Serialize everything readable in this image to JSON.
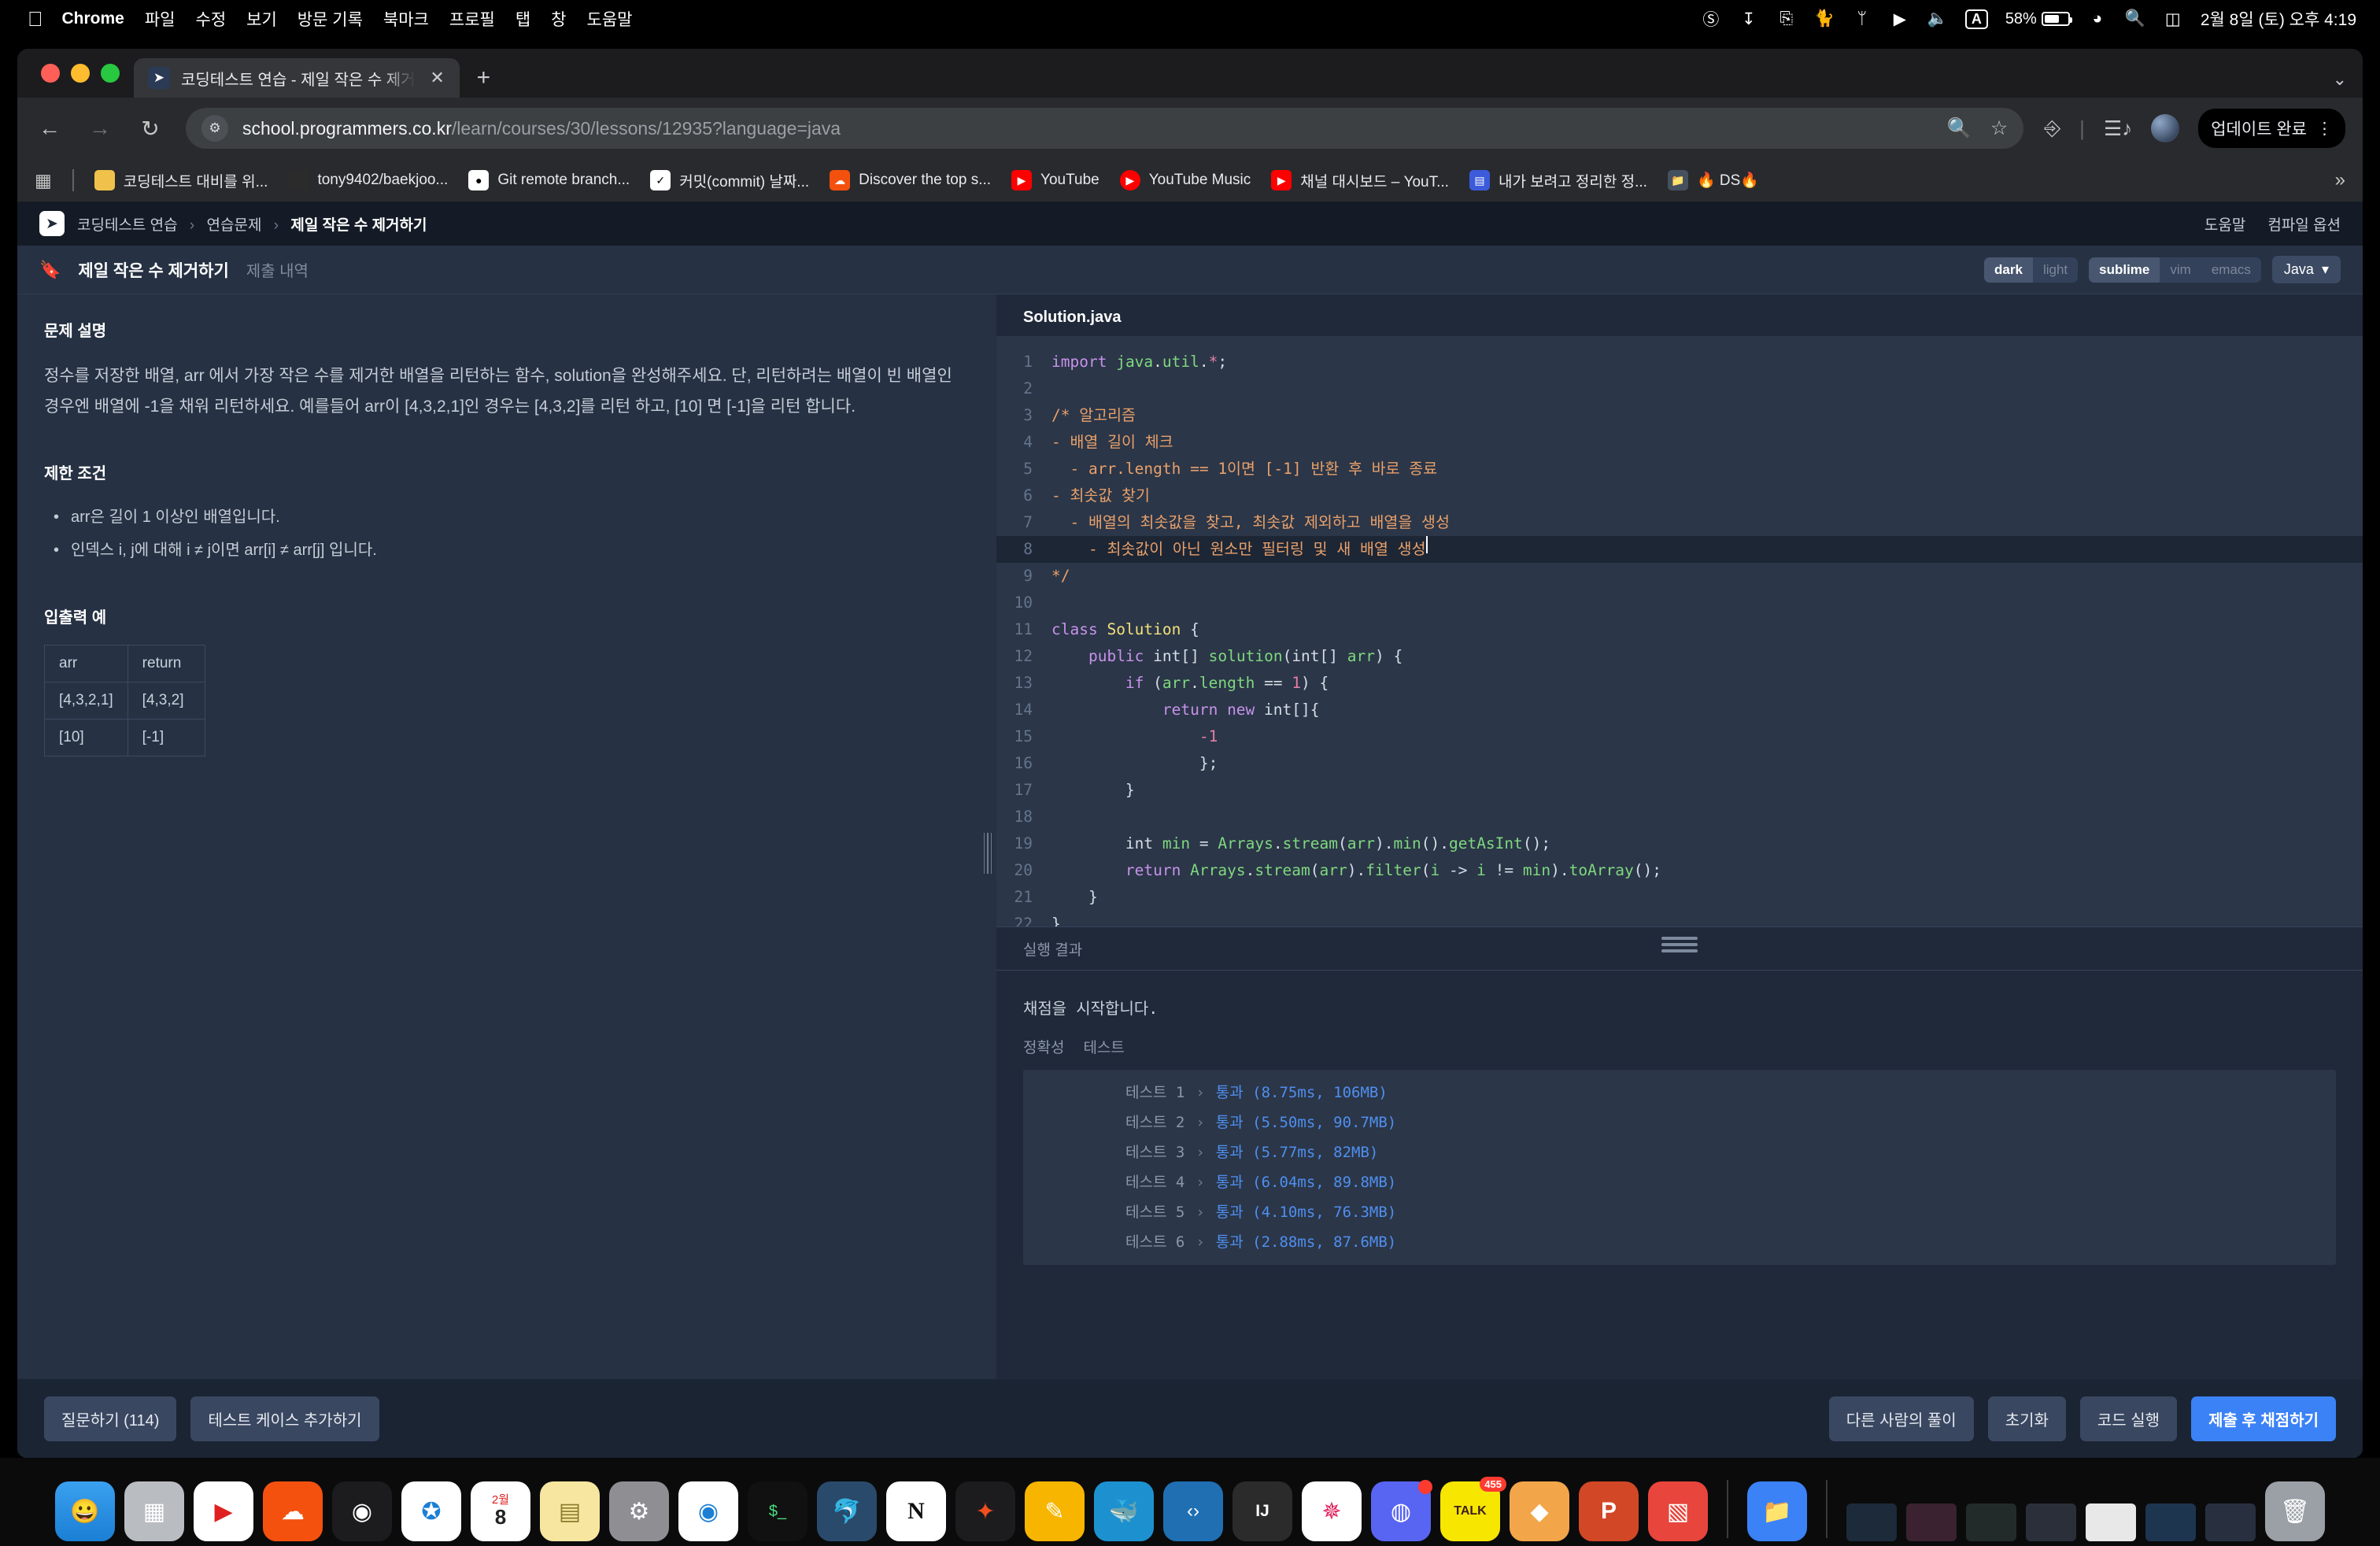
{
  "menubar": {
    "apple_icon": "apple-icon",
    "app": "Chrome",
    "items": [
      "파일",
      "수정",
      "보기",
      "방문 기록",
      "북마크",
      "프로필",
      "탭",
      "창",
      "도움말"
    ],
    "battery_percent": "58%",
    "clock": "2월 8일 (토) 오후 4:19",
    "input_source": "A",
    "status_icons": [
      "do-not-disturb-icon",
      "downloads-icon",
      "screen-mirroring-icon",
      "cat-icon",
      "bluetooth-icon",
      "now-playing-icon",
      "volume-icon",
      "input-source-icon",
      "battery-icon",
      "wifi-icon",
      "spotlight-search-icon",
      "control-center-icon"
    ]
  },
  "browser": {
    "tab": {
      "title": "코딩테스트 연습 - 제일 작은 수 제거",
      "favicon": "programmers-logo-icon",
      "close": "✕"
    },
    "new_tab": "+",
    "omnibox": {
      "host": "school.programmers.co.kr",
      "path": "/learn/courses/30/lessons/12935?language=java"
    },
    "update_button": "업데이트 완료",
    "bookmarks": [
      {
        "label": "코딩테스트 대비를 위...",
        "color": "#f0c24b",
        "glyph": "●"
      },
      {
        "label": "tony9402/baekjoo...",
        "color": "#2b2b2b",
        "glyph": "◐"
      },
      {
        "label": "Git remote branch...",
        "color": "#ffffff",
        "glyph": "🐧"
      },
      {
        "label": "커밋(commit) 날짜...",
        "color": "#ffffff",
        "glyph": "✎"
      },
      {
        "label": "Discover the top s...",
        "color": "#f4510f",
        "glyph": "☁"
      },
      {
        "label": "YouTube",
        "color": "#ff0000",
        "glyph": "▶"
      },
      {
        "label": "YouTube Music",
        "color": "#ff0000",
        "glyph": "◉"
      },
      {
        "label": "채널 대시보드 – YouT...",
        "color": "#ff0000",
        "glyph": "▶"
      },
      {
        "label": "내가 보려고 정리한 정...",
        "color": "#3b5bdb",
        "glyph": "▤"
      },
      {
        "label": "🔥 DS🔥",
        "color": "#46515f",
        "glyph": "🗀"
      }
    ],
    "bookmarks_overflow": "»"
  },
  "page": {
    "breadcrumb": {
      "root": "코딩테스트 연습",
      "mid": "연습문제",
      "current": "제일 작은 수 제거하기",
      "sep": "›"
    },
    "header_links": [
      "도움말",
      "컴파일 옵션"
    ],
    "tabs": {
      "problem": "제일 작은 수 제거하기",
      "history": "제출 내역"
    },
    "theme_seg": {
      "options": [
        "dark",
        "light"
      ],
      "selected": "dark"
    },
    "keymap_seg": {
      "options": [
        "sublime",
        "vim",
        "emacs"
      ],
      "selected": "sublime"
    },
    "language": "Java",
    "description": {
      "title": "문제 설명",
      "text": "정수를 저장한 배열, arr 에서 가장 작은 수를 제거한 배열을 리턴하는 함수, solution을 완성해주세요. 단, 리턴하려는 배열이 빈 배열인 경우엔 배열에 -1을 채워 리턴하세요. 예를들어 arr이 [4,3,2,1]인 경우는 [4,3,2]를 리턴 하고, [10] 면 [-1]을 리턴 합니다."
    },
    "constraints": {
      "title": "제한 조건",
      "items": [
        "arr은 길이 1 이상인 배열입니다.",
        "인덱스 i, j에 대해 i ≠ j이면 arr[i] ≠ arr[j] 입니다."
      ]
    },
    "io_example": {
      "title": "입출력 예",
      "headers": [
        "arr",
        "return"
      ],
      "rows": [
        [
          "[4,3,2,1]",
          "[4,3,2]"
        ],
        [
          "[10]",
          "[-1]"
        ]
      ]
    },
    "editor": {
      "filename": "Solution.java",
      "lines": [
        "import java.util.*;",
        "",
        "/* 알고리즘",
        "- 배열 길이 체크",
        "  - arr.length == 1이면 [-1] 반환 후 바로 종료",
        "- 최솟값 찾기",
        "  - 배열의 최솟값을 찾고, 최솟값 제외하고 배열을 생성",
        "    - 최솟값이 아닌 원소만 필터링 및 새 배열 생성",
        "*/",
        "",
        "class Solution {",
        "    public int[] solution(int[] arr) {",
        "        if (arr.length == 1) {",
        "            return new int[]{",
        "                -1",
        "                };",
        "        }",
        "",
        "        int min = Arrays.stream(arr).min().getAsInt();",
        "        return Arrays.stream(arr).filter(i -> i != min).toArray();",
        "    }",
        "}"
      ],
      "highlighted_line": 8,
      "total_lines": 22
    },
    "run_label": "실행 결과",
    "results": {
      "start_message": "채점을 시작합니다.",
      "tabs": [
        "정확성",
        "테스트"
      ],
      "rows": [
        {
          "name": "테스트 1",
          "chev": "›",
          "status": "통과 (8.75ms, 106MB)"
        },
        {
          "name": "테스트 2",
          "chev": "›",
          "status": "통과 (5.50ms, 90.7MB)"
        },
        {
          "name": "테스트 3",
          "chev": "›",
          "status": "통과 (5.77ms, 82MB)"
        },
        {
          "name": "테스트 4",
          "chev": "›",
          "status": "통과 (6.04ms, 89.8MB)"
        },
        {
          "name": "테스트 5",
          "chev": "›",
          "status": "통과 (4.10ms, 76.3MB)"
        },
        {
          "name": "테스트 6",
          "chev": "›",
          "status": "통과 (2.88ms, 87.6MB)"
        }
      ]
    },
    "footer": {
      "left": [
        "질문하기 (114)",
        "테스트 케이스 추가하기"
      ],
      "right": [
        "다른 사람의 풀이",
        "초기화",
        "코드 실행",
        "제출 후 채점하기"
      ],
      "primary_color": "#3b82f6"
    }
  },
  "dock": {
    "items": [
      {
        "name": "finder",
        "glyph": "🙂",
        "bg": "linear-gradient(180deg,#3aa0ef,#1b7fd4)"
      },
      {
        "name": "launchpad",
        "glyph": "▦",
        "bg": "#b9bcc1"
      },
      {
        "name": "quicktime",
        "glyph": "▶",
        "bg": "#ffffff"
      },
      {
        "name": "soundcloud",
        "glyph": "☁",
        "bg": "#f4510f"
      },
      {
        "name": "logic",
        "glyph": "◉",
        "bg": "#1c1c1e"
      },
      {
        "name": "safari",
        "glyph": "🧭",
        "bg": "#ffffff"
      },
      {
        "name": "calendar",
        "glyph": "8",
        "bg": "#ffffff"
      },
      {
        "name": "notes",
        "glyph": "▤",
        "bg": "#f6e6a0"
      },
      {
        "name": "system-settings",
        "glyph": "⚙",
        "bg": "#8e8e93"
      },
      {
        "name": "chrome",
        "glyph": "◎",
        "bg": "#ffffff"
      },
      {
        "name": "terminal",
        "glyph": "$_",
        "bg": "#111"
      },
      {
        "name": "mysql-workbench",
        "glyph": "🐬",
        "bg": "#2a4a6b"
      },
      {
        "name": "notion",
        "glyph": "N",
        "bg": "#ffffff"
      },
      {
        "name": "figma",
        "glyph": "✦",
        "bg": "#1c1c1e"
      },
      {
        "name": "sketch",
        "glyph": "✎",
        "bg": "#f7b500"
      },
      {
        "name": "docker",
        "glyph": "🐳",
        "bg": "#1d91d0"
      },
      {
        "name": "vscode",
        "glyph": "‹›",
        "bg": "#1f6fb2"
      },
      {
        "name": "intellij",
        "glyph": "IJ",
        "bg": "#2b2b2b"
      },
      {
        "name": "slack",
        "glyph": "✳",
        "bg": "#ffffff"
      },
      {
        "name": "discord",
        "glyph": "◍",
        "bg": "#5865f2"
      },
      {
        "name": "kakaotalk",
        "glyph": "TALK",
        "bg": "#f7e600"
      },
      {
        "name": "zeplin",
        "glyph": "◆",
        "bg": "#f2a649"
      },
      {
        "name": "powerpoint",
        "glyph": "P",
        "bg": "#d24726"
      },
      {
        "name": "keynote",
        "glyph": "◧",
        "bg": "#e8453c"
      },
      {
        "name": "downloads",
        "glyph": "🗀",
        "bg": "#3b82f6"
      }
    ],
    "badge_discord": "•",
    "badge_kakao": "455",
    "trash": "🗑"
  }
}
